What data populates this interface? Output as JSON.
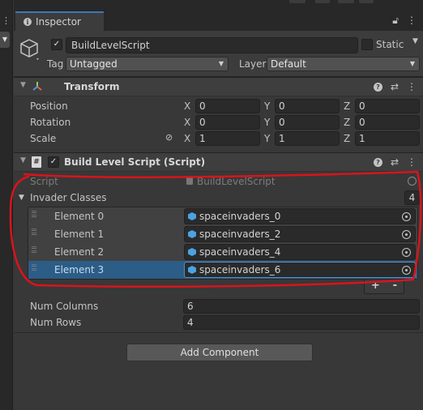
{
  "window": {
    "tab_label": "Inspector",
    "tab_icon": "info-icon",
    "lock_icon": "lock-icon",
    "menu_icon": "kebab-menu-icon"
  },
  "gameobject": {
    "name": "BuildLevelScript",
    "active": true,
    "static_label": "Static",
    "tag_label": "Tag",
    "tag_value": "Untagged",
    "layer_label": "Layer",
    "layer_value": "Default"
  },
  "transform": {
    "title": "Transform",
    "rows": [
      {
        "label": "Position",
        "x": "0",
        "y": "0",
        "z": "0"
      },
      {
        "label": "Rotation",
        "x": "0",
        "y": "0",
        "z": "0"
      },
      {
        "label": "Scale",
        "x": "1",
        "y": "1",
        "z": "1"
      }
    ],
    "axis_x": "X",
    "axis_y": "Y",
    "axis_z": "Z"
  },
  "script_component": {
    "title": "Build Level Script (Script)",
    "enabled": true,
    "script_label": "Script",
    "script_value": "BuildLevelScript",
    "list_label": "Invader Classes",
    "list_count": "4",
    "elements": [
      {
        "label": "Element 0",
        "value": "spaceinvaders_0",
        "selected": false
      },
      {
        "label": "Element 1",
        "value": "spaceinvaders_2",
        "selected": false
      },
      {
        "label": "Element 2",
        "value": "spaceinvaders_4",
        "selected": false
      },
      {
        "label": "Element 3",
        "value": "spaceinvaders_6",
        "selected": true
      }
    ],
    "add_symbol": "+",
    "remove_symbol": "-",
    "num_columns_label": "Num Columns",
    "num_columns_value": "6",
    "num_rows_label": "Num Rows",
    "num_rows_value": "4"
  },
  "add_component_label": "Add Component",
  "colors": {
    "selection": "#2c5d87",
    "accent": "#3a79bb",
    "annotation": "#d8141c"
  }
}
